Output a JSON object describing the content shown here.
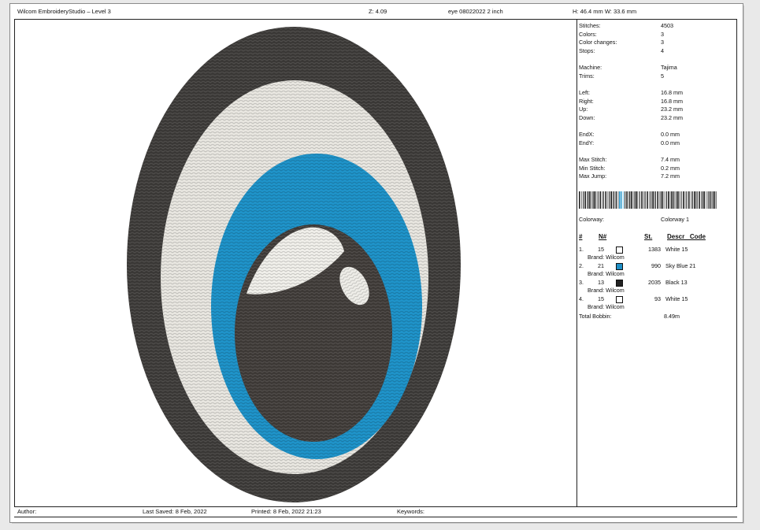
{
  "header": {
    "app_title": "Wilcom EmbroideryStudio – Level 3",
    "zoom": "Z: 4.09",
    "design_name": "eye 08022022 2 inch",
    "size": "H: 46.4 mm   W: 33.6 mm"
  },
  "stats": [
    {
      "label": "Stitches:",
      "value": "4503"
    },
    {
      "label": "Colors:",
      "value": "3"
    },
    {
      "label": "Color changes:",
      "value": "3"
    },
    {
      "label": "Stops:",
      "value": "4"
    },
    {
      "label": "Machine:",
      "value": "Tajima"
    },
    {
      "label": "Trims:",
      "value": "5"
    },
    {
      "label": "Left:",
      "value": "16.8 mm"
    },
    {
      "label": "Right:",
      "value": "16.8 mm"
    },
    {
      "label": "Up:",
      "value": "23.2 mm"
    },
    {
      "label": "Down:",
      "value": "23.2 mm"
    },
    {
      "label": "EndX:",
      "value": "0.0 mm"
    },
    {
      "label": "EndY:",
      "value": "0.0 mm"
    },
    {
      "label": "Max Stitch:",
      "value": "7.4 mm"
    },
    {
      "label": "Min Stitch:",
      "value": "0.2 mm"
    },
    {
      "label": "Max Jump:",
      "value": "7.2 mm"
    }
  ],
  "colorway": {
    "label": "Colorway:",
    "value": "Colorway 1"
  },
  "color_table": {
    "headers": {
      "index": "#",
      "number": "N#",
      "stitches": "St.",
      "descr_code": "Descr   Code"
    },
    "rows": [
      {
        "index": "1.",
        "number": "15",
        "color": "#ffffff",
        "stitches": "1383",
        "descr": "White 15",
        "brand": "Brand: Wilcom"
      },
      {
        "index": "2.",
        "number": "21",
        "color": "#1e8fc6",
        "stitches": "990",
        "descr": "Sky Blue 21",
        "brand": "Brand: Wilcom"
      },
      {
        "index": "3.",
        "number": "13",
        "color": "#222222",
        "stitches": "2035",
        "descr": "Black 13",
        "brand": "Brand: Wilcom"
      },
      {
        "index": "4.",
        "number": "15",
        "color": "#ffffff",
        "stitches": "93",
        "descr": "White 15",
        "brand": "Brand: Wilcom"
      }
    ],
    "total_bobbin": {
      "label": "Total Bobbin:",
      "value": "8.49m"
    }
  },
  "footer": {
    "author": "Author:",
    "last_saved": "Last Saved:  8 Feb, 2022",
    "printed": "Printed:  8 Feb, 2022 21:23",
    "keywords": "Keywords:"
  }
}
